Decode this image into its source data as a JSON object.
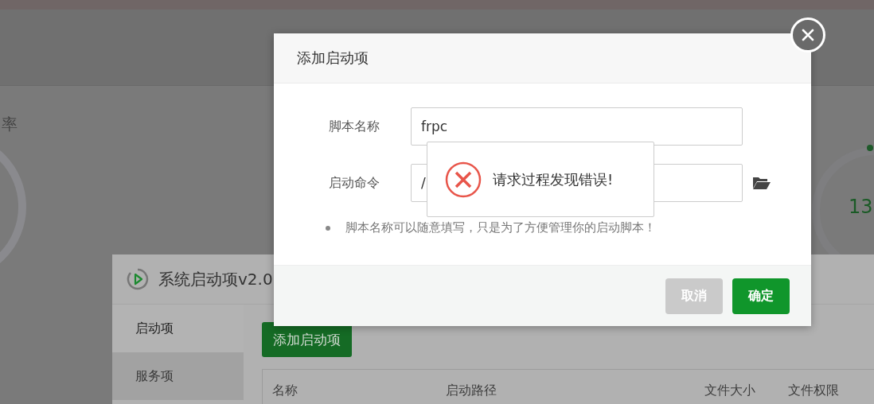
{
  "background": {
    "left_label": "率",
    "right_value": "13"
  },
  "back_window": {
    "title": "系统启动项v2.0",
    "sidebar": [
      {
        "label": "启动项",
        "selected": true
      },
      {
        "label": "服务项",
        "selected": false
      }
    ],
    "add_button": "添加启动项",
    "columns": [
      "名称",
      "启动路径",
      "文件大小",
      "文件权限"
    ]
  },
  "dialog": {
    "title": "添加启动项",
    "fields": [
      {
        "label": "脚本名称",
        "value": "frpc"
      },
      {
        "label": "启动命令",
        "value": "/"
      }
    ],
    "note": "脚本名称可以随意填写，只是为了方便管理你的启动脚本！",
    "buttons": [
      {
        "label": "取消",
        "kind": "cancel"
      },
      {
        "label": "确定",
        "kind": "primary"
      }
    ]
  },
  "toast": {
    "message": "请求过程发现错误!"
  }
}
